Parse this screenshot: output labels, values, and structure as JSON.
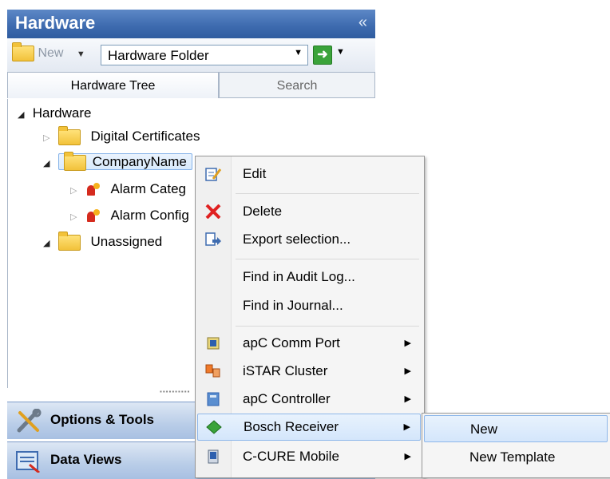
{
  "panel": {
    "title": "Hardware",
    "collapse_glyph": "«",
    "toolbar": {
      "new_label": "New",
      "folder_select_value": "Hardware Folder"
    },
    "tabs": [
      {
        "label": "Hardware Tree"
      },
      {
        "label": "Search"
      }
    ],
    "tree": {
      "root": "Hardware",
      "items": [
        {
          "label": "Digital Certificates"
        },
        {
          "label": "CompanyName"
        },
        {
          "label": "Alarm Categ"
        },
        {
          "label": "Alarm Config"
        },
        {
          "label": "Unassigned"
        }
      ]
    },
    "nav": [
      {
        "label": "Options & Tools",
        "icon": "tools-icon"
      },
      {
        "label": "Data Views",
        "icon": "data-views-icon"
      }
    ]
  },
  "context_menu": {
    "items": [
      {
        "label": "Edit",
        "icon": "edit-icon"
      },
      {
        "label": "Delete",
        "icon": "delete-icon"
      },
      {
        "label": "Export selection...",
        "icon": "export-icon"
      },
      {
        "label": "Find in Audit Log..."
      },
      {
        "label": "Find in Journal..."
      },
      {
        "label": "apC Comm Port",
        "icon": "comm-port-icon"
      },
      {
        "label": "iSTAR Cluster",
        "icon": "cluster-icon"
      },
      {
        "label": "apC Controller",
        "icon": "controller-icon"
      },
      {
        "label": "Bosch Receiver",
        "icon": "receiver-icon"
      },
      {
        "label": "C-CURE Mobile",
        "icon": "mobile-icon"
      }
    ]
  },
  "submenu": {
    "items": [
      {
        "label": "New"
      },
      {
        "label": "New Template"
      }
    ]
  },
  "colors": {
    "header_blue": "#3f6cb0",
    "highlight_blue": "#d4e6fb",
    "delete_red": "#e02020"
  }
}
